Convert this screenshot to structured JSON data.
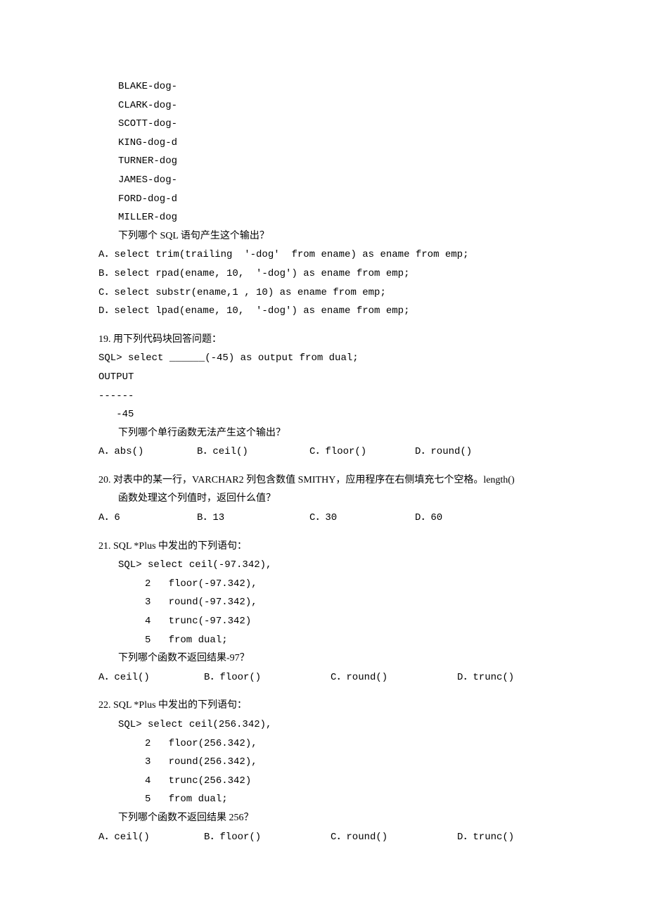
{
  "top_output": {
    "lines": [
      "BLAKE-dog-",
      "CLARK-dog-",
      "SCOTT-dog-",
      "KING-dog-d",
      "TURNER-dog",
      "JAMES-dog-",
      "FORD-dog-d",
      "MILLER-dog"
    ],
    "prompt": "下列哪个 SQL 语句产生这个输出？",
    "choices": {
      "a": "A．select trim(trailing  '-dog'  from ename) as ename from emp;",
      "b": "B．select rpad(ename, 10,  '-dog') as ename from emp;",
      "c": "C．select substr(ename,1 , 10) as ename from emp;",
      "d": "D．select lpad(ename, 10,  '-dog') as ename from emp;"
    }
  },
  "q19": {
    "title": "19. 用下列代码块回答问题：",
    "sql": "SQL> select ______(-45) as output from dual;",
    "out_h": "OUTPUT",
    "sep": "------",
    "val": "   -45",
    "prompt": "下列哪个单行函数无法产生这个输出？",
    "choices": {
      "a": "A．abs()",
      "b": "B．ceil()",
      "c": "C．floor()",
      "d": "D．round()"
    }
  },
  "q20": {
    "line1": "20. 对表中的某一行，VARCHAR2 列包含数值 SMITHY，应用程序在右侧填充七个空格。length()",
    "line2": "函数处理这个列值时，返回什么值？",
    "choices": {
      "a": "A．6",
      "b": "B．13",
      "c": "C．30",
      "d": "D．60"
    }
  },
  "q21": {
    "title": "21. SQL *Plus 中发出的下列语句：",
    "sql": {
      "l1": "SQL> select ceil(-97.342),",
      "l2": "2   floor(-97.342),",
      "l3": "3   round(-97.342),",
      "l4": "4   trunc(-97.342)",
      "l5": "5   from dual;"
    },
    "prompt": "下列哪个函数不返回结果-97？",
    "choices": {
      "a": "A．ceil()",
      "b": "B．floor()",
      "c": "C．round()",
      "d": "D．trunc()"
    }
  },
  "q22": {
    "title": "22. SQL *Plus 中发出的下列语句：",
    "sql": {
      "l1": "SQL> select ceil(256.342),",
      "l2": "2   floor(256.342),",
      "l3": "3   round(256.342),",
      "l4": "4   trunc(256.342)",
      "l5": "5   from dual;"
    },
    "prompt": "下列哪个函数不返回结果 256？",
    "choices": {
      "a": "A．ceil()",
      "b": "B．floor()",
      "c": "C．round()",
      "d": "D．trunc()"
    }
  }
}
